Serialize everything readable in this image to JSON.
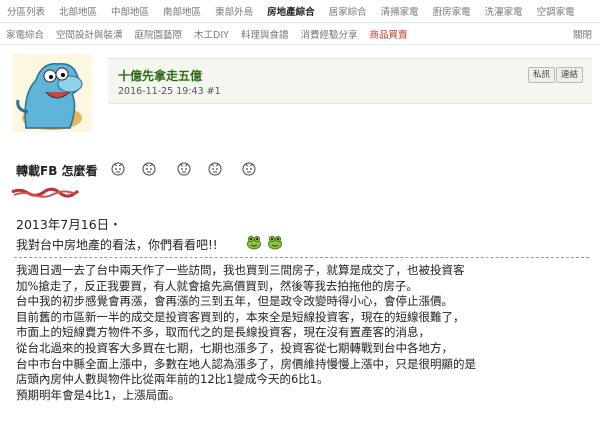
{
  "nav_top": [
    "分區列表",
    "北部地區",
    "中部地區",
    "南部地區",
    "東部外島",
    "房地產綜合",
    "居家綜合",
    "清掃家電",
    "廚房家電",
    "洗濯家電",
    "空調家電"
  ],
  "nav_top_active": "房地產綜合",
  "nav_sub": [
    "家電綜合",
    "空間設計與裝潢",
    "庭院園藝際",
    "木工DIY",
    "料理與食譜",
    "消費經驗分享",
    "商品買賣"
  ],
  "nav_sub_right": "關閉",
  "post": {
    "author": "十億先拿走五億",
    "timestamp": "2016-11-25 19:43",
    "floor": "#1",
    "btn_private": "私訊",
    "btn_link": "連結"
  },
  "thread_title": "轉載FB 怎麼看",
  "content": {
    "date": "2013年7月16日・",
    "question": "我對台中房地產的看法，你們看看吧!!",
    "paragraphs": [
      "我週日週一去了台中兩天作了一些訪問，我也買到三間房子，就算是成交了，也被投資客",
      "加%搶走了，反正我要買，有人就會搶先高價買到，然後等我去拍拖他的房子。",
      "台中我的初步感覺會再漲，會再漲的三到五年，但是政令改變時得小心，會停止漲價。",
      "目前舊的市區新一半的成交是投資客買到的，本來全是短線投資客，現在的短線很難了，",
      "市面上的短線賣方物件不多，取而代之的是長線投資客，現在沒有置產客的消息，",
      "從台北過來的投資客大多買在七期，七期也漲多了，投資客從七期轉戰到台中各地方，",
      "台中市台中縣全面上漲中，多數在地人認為漲多了，房價維持慢慢上漲中，只是很明顯的是",
      "店頭內房仲人數與物件比從兩年前的12比1變成今天的6比1。",
      "預期明年會是4比1，上漲局面。"
    ]
  },
  "icons": {
    "avatar": "blue-dinosaur-avatar",
    "title_smileys": "sweat-smiley-icon",
    "frog": "green-frog-icon"
  },
  "colors": {
    "author": "#2e6a1a",
    "subnav_highlight": "#c0392b",
    "postbar_bg": "#f4f7f0"
  }
}
